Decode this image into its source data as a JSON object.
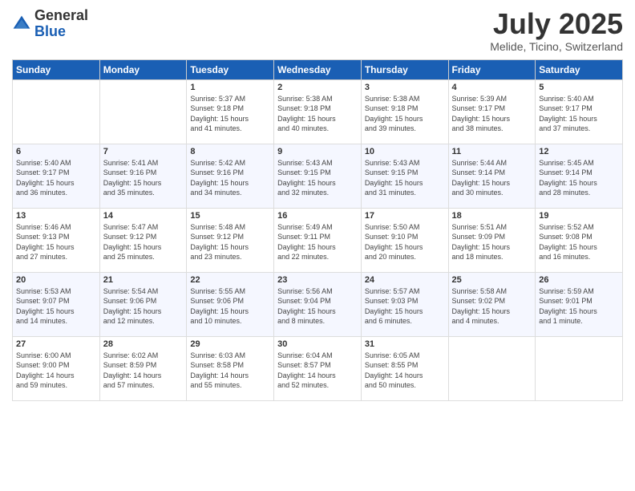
{
  "header": {
    "logo_line1": "General",
    "logo_line2": "Blue",
    "month": "July 2025",
    "location": "Melide, Ticino, Switzerland"
  },
  "weekdays": [
    "Sunday",
    "Monday",
    "Tuesday",
    "Wednesday",
    "Thursday",
    "Friday",
    "Saturday"
  ],
  "weeks": [
    [
      {
        "day": "",
        "info": ""
      },
      {
        "day": "",
        "info": ""
      },
      {
        "day": "1",
        "info": "Sunrise: 5:37 AM\nSunset: 9:18 PM\nDaylight: 15 hours\nand 41 minutes."
      },
      {
        "day": "2",
        "info": "Sunrise: 5:38 AM\nSunset: 9:18 PM\nDaylight: 15 hours\nand 40 minutes."
      },
      {
        "day": "3",
        "info": "Sunrise: 5:38 AM\nSunset: 9:18 PM\nDaylight: 15 hours\nand 39 minutes."
      },
      {
        "day": "4",
        "info": "Sunrise: 5:39 AM\nSunset: 9:17 PM\nDaylight: 15 hours\nand 38 minutes."
      },
      {
        "day": "5",
        "info": "Sunrise: 5:40 AM\nSunset: 9:17 PM\nDaylight: 15 hours\nand 37 minutes."
      }
    ],
    [
      {
        "day": "6",
        "info": "Sunrise: 5:40 AM\nSunset: 9:17 PM\nDaylight: 15 hours\nand 36 minutes."
      },
      {
        "day": "7",
        "info": "Sunrise: 5:41 AM\nSunset: 9:16 PM\nDaylight: 15 hours\nand 35 minutes."
      },
      {
        "day": "8",
        "info": "Sunrise: 5:42 AM\nSunset: 9:16 PM\nDaylight: 15 hours\nand 34 minutes."
      },
      {
        "day": "9",
        "info": "Sunrise: 5:43 AM\nSunset: 9:15 PM\nDaylight: 15 hours\nand 32 minutes."
      },
      {
        "day": "10",
        "info": "Sunrise: 5:43 AM\nSunset: 9:15 PM\nDaylight: 15 hours\nand 31 minutes."
      },
      {
        "day": "11",
        "info": "Sunrise: 5:44 AM\nSunset: 9:14 PM\nDaylight: 15 hours\nand 30 minutes."
      },
      {
        "day": "12",
        "info": "Sunrise: 5:45 AM\nSunset: 9:14 PM\nDaylight: 15 hours\nand 28 minutes."
      }
    ],
    [
      {
        "day": "13",
        "info": "Sunrise: 5:46 AM\nSunset: 9:13 PM\nDaylight: 15 hours\nand 27 minutes."
      },
      {
        "day": "14",
        "info": "Sunrise: 5:47 AM\nSunset: 9:12 PM\nDaylight: 15 hours\nand 25 minutes."
      },
      {
        "day": "15",
        "info": "Sunrise: 5:48 AM\nSunset: 9:12 PM\nDaylight: 15 hours\nand 23 minutes."
      },
      {
        "day": "16",
        "info": "Sunrise: 5:49 AM\nSunset: 9:11 PM\nDaylight: 15 hours\nand 22 minutes."
      },
      {
        "day": "17",
        "info": "Sunrise: 5:50 AM\nSunset: 9:10 PM\nDaylight: 15 hours\nand 20 minutes."
      },
      {
        "day": "18",
        "info": "Sunrise: 5:51 AM\nSunset: 9:09 PM\nDaylight: 15 hours\nand 18 minutes."
      },
      {
        "day": "19",
        "info": "Sunrise: 5:52 AM\nSunset: 9:08 PM\nDaylight: 15 hours\nand 16 minutes."
      }
    ],
    [
      {
        "day": "20",
        "info": "Sunrise: 5:53 AM\nSunset: 9:07 PM\nDaylight: 15 hours\nand 14 minutes."
      },
      {
        "day": "21",
        "info": "Sunrise: 5:54 AM\nSunset: 9:06 PM\nDaylight: 15 hours\nand 12 minutes."
      },
      {
        "day": "22",
        "info": "Sunrise: 5:55 AM\nSunset: 9:06 PM\nDaylight: 15 hours\nand 10 minutes."
      },
      {
        "day": "23",
        "info": "Sunrise: 5:56 AM\nSunset: 9:04 PM\nDaylight: 15 hours\nand 8 minutes."
      },
      {
        "day": "24",
        "info": "Sunrise: 5:57 AM\nSunset: 9:03 PM\nDaylight: 15 hours\nand 6 minutes."
      },
      {
        "day": "25",
        "info": "Sunrise: 5:58 AM\nSunset: 9:02 PM\nDaylight: 15 hours\nand 4 minutes."
      },
      {
        "day": "26",
        "info": "Sunrise: 5:59 AM\nSunset: 9:01 PM\nDaylight: 15 hours\nand 1 minute."
      }
    ],
    [
      {
        "day": "27",
        "info": "Sunrise: 6:00 AM\nSunset: 9:00 PM\nDaylight: 14 hours\nand 59 minutes."
      },
      {
        "day": "28",
        "info": "Sunrise: 6:02 AM\nSunset: 8:59 PM\nDaylight: 14 hours\nand 57 minutes."
      },
      {
        "day": "29",
        "info": "Sunrise: 6:03 AM\nSunset: 8:58 PM\nDaylight: 14 hours\nand 55 minutes."
      },
      {
        "day": "30",
        "info": "Sunrise: 6:04 AM\nSunset: 8:57 PM\nDaylight: 14 hours\nand 52 minutes."
      },
      {
        "day": "31",
        "info": "Sunrise: 6:05 AM\nSunset: 8:55 PM\nDaylight: 14 hours\nand 50 minutes."
      },
      {
        "day": "",
        "info": ""
      },
      {
        "day": "",
        "info": ""
      }
    ]
  ]
}
